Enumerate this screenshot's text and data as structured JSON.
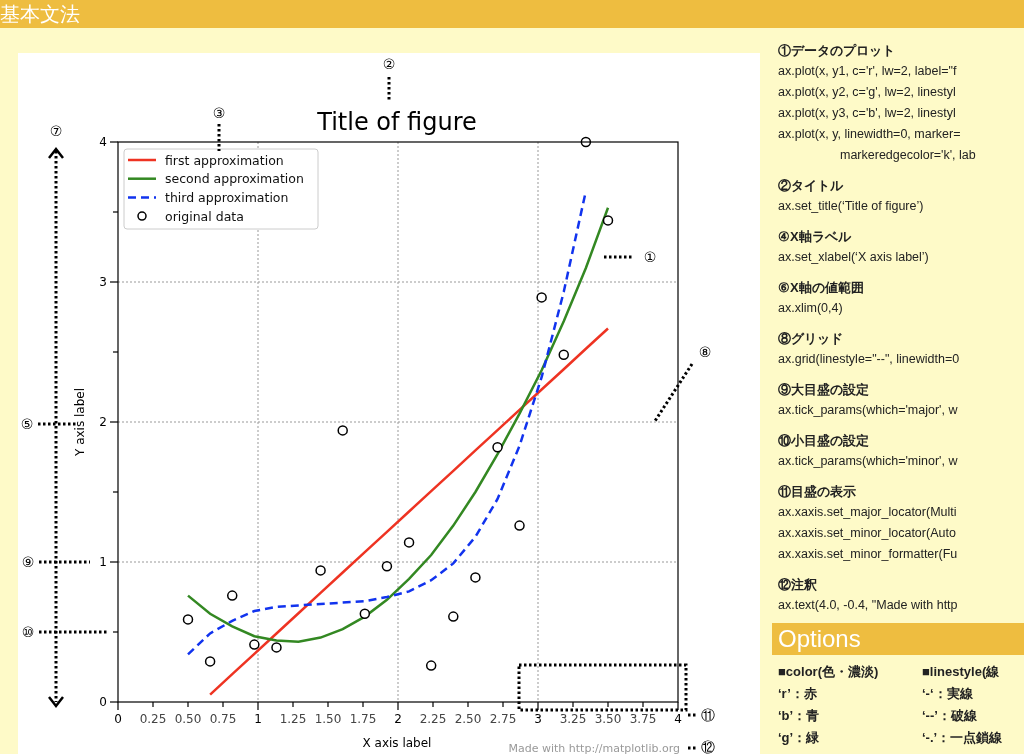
{
  "header": {
    "title": "基本文法"
  },
  "figure": {
    "callouts": [
      "②",
      "③",
      "⑦",
      "①",
      "⑧",
      "⑤",
      "⑨",
      "⑩",
      "⑪",
      "⑫"
    ],
    "note": "Made with http://matplotlib.org",
    "chart_data": {
      "type": "line",
      "title": "Title of figure",
      "xlabel": "X axis label",
      "ylabel": "Y axis label",
      "xlim": [
        0,
        4
      ],
      "ylim": [
        0,
        4
      ],
      "grid": true,
      "legend": true,
      "x": [
        0.5,
        0.658,
        0.816,
        0.974,
        1.132,
        1.289,
        1.447,
        1.605,
        1.763,
        1.921,
        2.079,
        2.237,
        2.395,
        2.553,
        2.711,
        2.868,
        3.026,
        3.184,
        3.342,
        3.5
      ],
      "series": [
        {
          "name": "first approximation",
          "line_style": "solid",
          "color": "#ee3322",
          "values": [
            null,
            0.053,
            0.199,
            0.344,
            0.489,
            0.634,
            0.779,
            0.925,
            1.07,
            1.215,
            1.361,
            1.506,
            1.651,
            1.797,
            1.942,
            2.087,
            2.232,
            2.377,
            2.523,
            2.668
          ]
        },
        {
          "name": "second approximation",
          "line_style": "solid",
          "color": "#338822",
          "values": [
            0.76,
            0.63,
            0.54,
            0.47,
            0.44,
            0.43,
            0.46,
            0.52,
            0.61,
            0.73,
            0.88,
            1.05,
            1.26,
            1.5,
            1.77,
            2.06,
            2.37,
            2.72,
            3.1,
            3.53
          ]
        },
        {
          "name": "third approximation",
          "line_style": "dashed",
          "color": "#1133ee",
          "values": [
            0.34,
            0.49,
            0.58,
            0.65,
            0.68,
            0.69,
            0.7,
            0.71,
            0.72,
            0.75,
            0.79,
            0.87,
            0.99,
            1.18,
            1.45,
            1.83,
            2.32,
            2.93,
            3.65,
            null
          ]
        },
        {
          "name": "original data",
          "type": "scatter",
          "marker": "o",
          "color": "#000000",
          "values": [
            0.59,
            0.29,
            0.76,
            0.41,
            0.39,
            null,
            0.94,
            1.94,
            0.63,
            0.97,
            1.14,
            0.26,
            0.61,
            0.89,
            1.82,
            1.26,
            2.89,
            2.48,
            4.0,
            3.44
          ]
        }
      ],
      "xticks": [
        {
          "value": 0,
          "label": "0"
        },
        {
          "value": 0.25,
          "label": "0.25"
        },
        {
          "value": 0.5,
          "label": "0.50"
        },
        {
          "value": 0.75,
          "label": "0.75"
        },
        {
          "value": 1,
          "label": "1"
        },
        {
          "value": 1.25,
          "label": "1.25"
        },
        {
          "value": 1.5,
          "label": "1.50"
        },
        {
          "value": 1.75,
          "label": "1.75"
        },
        {
          "value": 2,
          "label": "2"
        },
        {
          "value": 2.25,
          "label": "2.25"
        },
        {
          "value": 2.5,
          "label": "2.50"
        },
        {
          "value": 2.75,
          "label": "2.75"
        },
        {
          "value": 3,
          "label": "3"
        },
        {
          "value": 3.25,
          "label": "3.25"
        },
        {
          "value": 3.5,
          "label": "3.50"
        },
        {
          "value": 3.75,
          "label": "3.75"
        },
        {
          "value": 4,
          "label": "4"
        }
      ],
      "yticks": [
        0,
        1,
        2,
        3,
        4
      ]
    }
  },
  "notes": [
    {
      "heading": "①データのプロット",
      "lines": [
        "ax.plot(x, y1, c='r', lw=2, label=\"f",
        "ax.plot(x, y2, c='g', lw=2, linestyl",
        "ax.plot(x, y3, c='b', lw=2, linestyl",
        "ax.plot(x, y, linewidth=0, marker=",
        "markeredgecolor='k', lab"
      ]
    },
    {
      "heading": "②タイトル",
      "lines": [
        "ax.set_title(‘Title of figure’)"
      ]
    },
    {
      "heading": "④X軸ラベル",
      "lines": [
        "ax.set_xlabel(‘X axis label’)"
      ]
    },
    {
      "heading": "⑥X軸の値範囲",
      "lines": [
        "ax.xlim(0,4)"
      ]
    },
    {
      "heading": "⑧グリッド",
      "lines": [
        "ax.grid(linestyle=\"--\", linewidth=0"
      ]
    },
    {
      "heading": "⑨大目盛の設定",
      "lines": [
        "ax.tick_params(which='major', w"
      ]
    },
    {
      "heading": "⑩小目盛の設定",
      "lines": [
        "ax.tick_params(which='minor', w"
      ]
    },
    {
      "heading": "⑪目盛の表示",
      "lines": [
        "ax.xaxis.set_major_locator(Multi",
        "ax.xaxis.set_minor_locator(Auto",
        "ax.xaxis.set_minor_formatter(Fu"
      ]
    },
    {
      "heading": "⑫注釈",
      "lines": [
        "ax.text(4.0, -0.4, \"Made with http"
      ]
    }
  ],
  "options": {
    "title": "Options",
    "columns": [
      {
        "heading": "■color(色・濃淡)",
        "items": [
          "‘r’：赤",
          "‘b’：青",
          "‘g’：緑"
        ]
      },
      {
        "heading": "■linestyle(線",
        "items": [
          "‘-‘：実線",
          "‘--’：破線",
          "‘-.’：一点鎖線"
        ]
      }
    ]
  }
}
